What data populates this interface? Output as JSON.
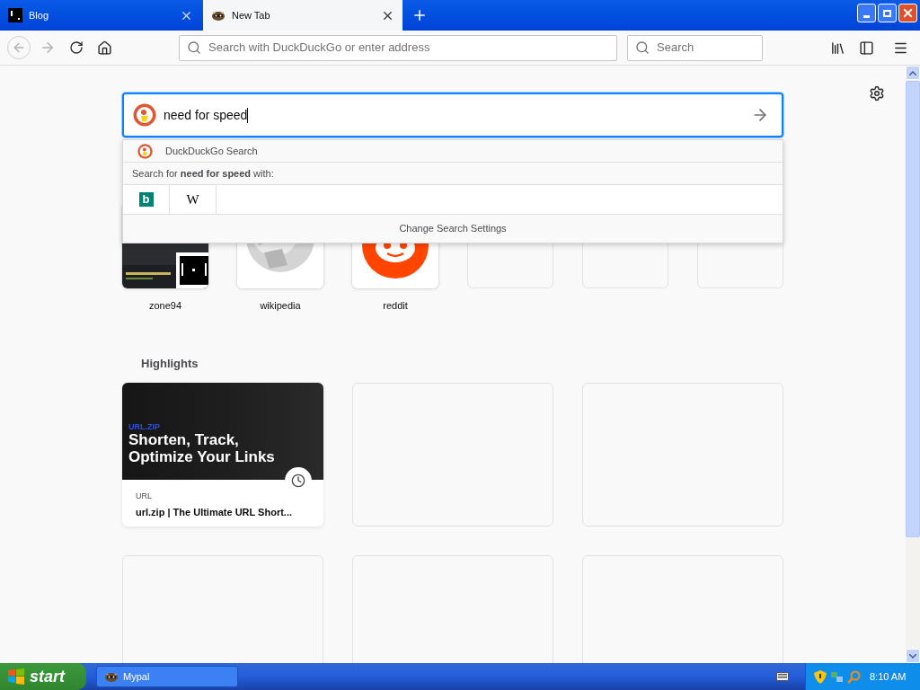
{
  "tabs": [
    {
      "title": "Blog",
      "kind": "terminal",
      "selected": false
    },
    {
      "title": "New Tab",
      "kind": "raccoon",
      "selected": true
    }
  ],
  "toolbar": {
    "address_placeholder": "Search with DuckDuckGo or enter address",
    "search_placeholder": "Search"
  },
  "search": {
    "value": "need for speed"
  },
  "dropdown": {
    "engine": "DuckDuckGo Search",
    "prompt": "Search for **need for speed** with:",
    "engines": [
      {
        "kind": "bing",
        "label": "b"
      },
      {
        "kind": "wikipedia",
        "label": "W"
      }
    ],
    "settings": "Change Search Settings"
  },
  "top_sites": [
    {
      "kind": "screenshot",
      "label": "zone94"
    },
    {
      "kind": "globe",
      "label": "wikipedia"
    },
    {
      "kind": "alien",
      "label": "reddit"
    },
    {
      "kind": "empty"
    },
    {
      "kind": "empty"
    },
    {
      "kind": "empty"
    }
  ],
  "highlights": {
    "title": "Highlights",
    "cards": [
      {
        "kind": "page",
        "tag": "URL.ZIP",
        "headline": "Shorten, Track, Optimize Your Links",
        "source": "URL",
        "title": "url.zip | The Ultimate URL Short..."
      },
      {
        "kind": "empty"
      },
      {
        "kind": "empty"
      },
      {
        "kind": "empty"
      },
      {
        "kind": "empty"
      },
      {
        "kind": "empty"
      }
    ]
  },
  "taskbar": {
    "start": "start",
    "tasks": [
      {
        "title": "Mypal"
      }
    ],
    "clock": "8:10 AM"
  }
}
